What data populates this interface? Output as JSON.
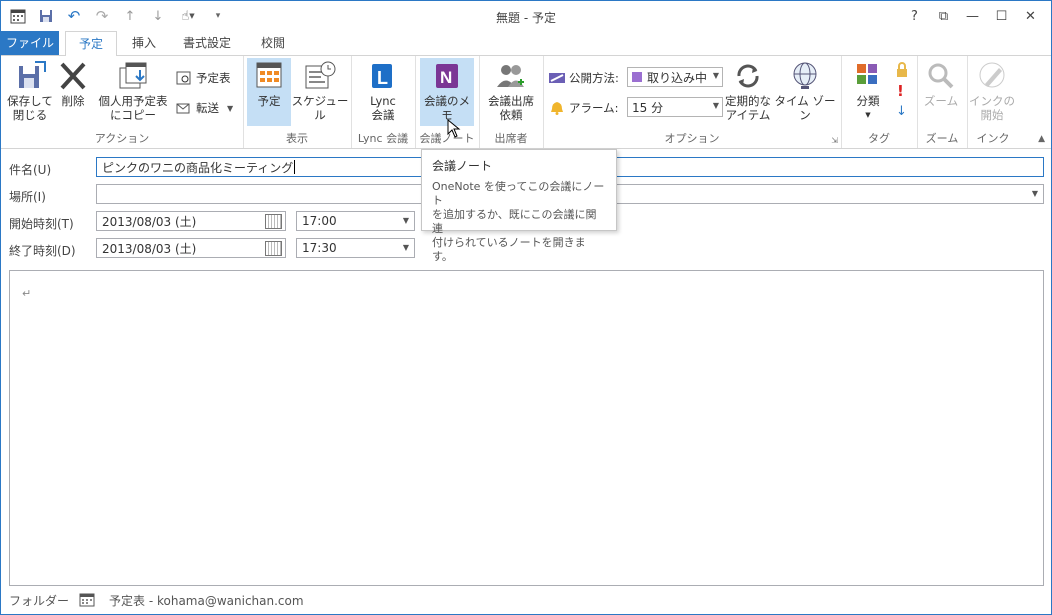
{
  "window": {
    "title": "無題 - 予定"
  },
  "window_controls": {
    "help": "?",
    "restore_ribbon": "⧉",
    "minimize": "—",
    "maximize": "☐",
    "close": "✕"
  },
  "tabs": [
    {
      "label": "ファイル"
    },
    {
      "label": "予定"
    },
    {
      "label": "挿入"
    },
    {
      "label": "書式設定"
    },
    {
      "label": "校閲"
    }
  ],
  "ribbon": {
    "actions": {
      "group": "アクション",
      "save_close": [
        "保存して",
        "閉じる"
      ],
      "delete": "削除",
      "copy_personal": [
        "個人用予定表",
        "にコピー"
      ],
      "calendar": "予定表",
      "forward": "転送"
    },
    "show": {
      "group": "表示",
      "appointment": "予定",
      "schedule": "スケジュール"
    },
    "lync": {
      "group": "Lync 会議",
      "button": [
        "Lync",
        "会議"
      ]
    },
    "meeting_notes": {
      "group": "会議ノート",
      "button": "会議のメモ"
    },
    "attendees": {
      "group": "出席者",
      "button": [
        "会議出席",
        "依頼"
      ]
    },
    "options": {
      "group": "オプション",
      "show_as_label": "公開方法:",
      "show_as_value": "取り込み中",
      "reminder_label": "アラーム:",
      "reminder_value": "15 分",
      "recurrence": [
        "定期的な",
        "アイテム"
      ],
      "timezone": "タイム ゾーン"
    },
    "tags": {
      "group": "タグ",
      "categorize": "分類"
    },
    "zoom": {
      "group": "ズーム",
      "button": "ズーム"
    },
    "ink": {
      "group": "インク",
      "button": [
        "インクの",
        "開始"
      ]
    }
  },
  "form": {
    "subject_label": "件名(U)",
    "subject_value": "ピンクのワニの商品化ミーティング",
    "location_label": "場所(I)",
    "location_value": "",
    "start_label": "開始時刻(T)",
    "start_date": "2013/08/03 (土)",
    "start_time": "17:00",
    "end_label": "終了時刻(D)",
    "end_date": "2013/08/03 (土)",
    "end_time": "17:30",
    "body_mark": "↵"
  },
  "tooltip": {
    "title": "会議ノート",
    "desc": [
      "OneNote を使ってこの会議にノート",
      "を追加するか、既にこの会議に関連",
      "付けられているノートを開きます。"
    ]
  },
  "status": {
    "folder_label": "フォルダー",
    "folder_value": "予定表 - kohama@wanichan.com"
  },
  "colors": {
    "accent": "#2b78c5",
    "onenote": "#7b3695",
    "busy": "#9b6fd1"
  }
}
